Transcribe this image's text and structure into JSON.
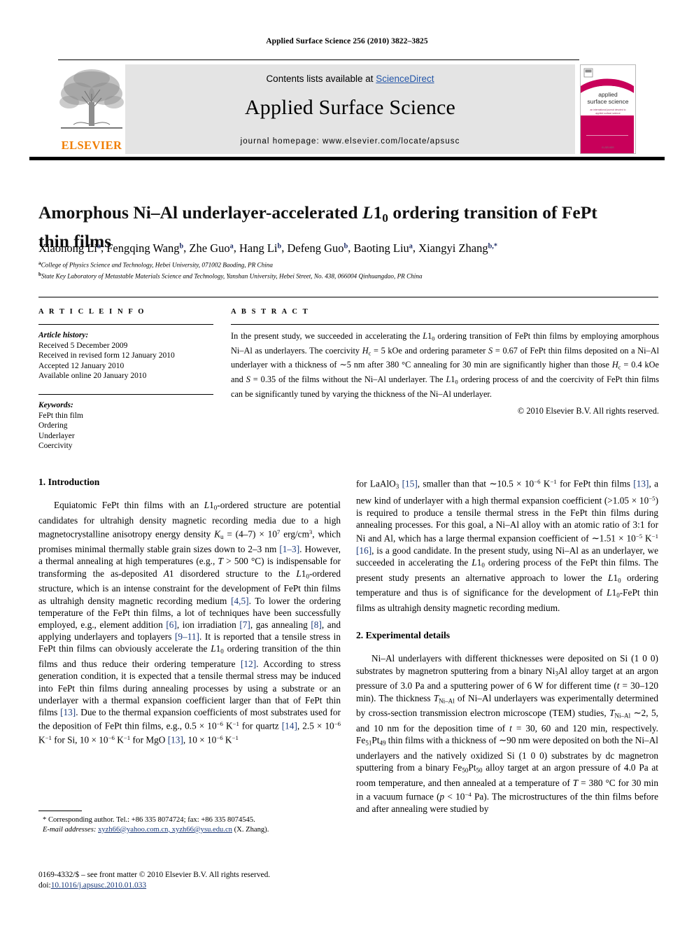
{
  "running_head": "Applied Surface Science 256 (2010) 3822–3825",
  "header": {
    "contents_prefix": "Contents lists available at ",
    "sciencedirect": "ScienceDirect",
    "journal_title": "Applied Surface Science",
    "homepage": "journal homepage: www.elsevier.com/locate/apsusc",
    "publisher_word": "ELSEVIER",
    "publisher_accent_color": "#F07D00",
    "link_color": "#2456a8",
    "cover": {
      "line1": "applied",
      "line2": "surface science",
      "subtitle": "an international journal devoted to applied surface science",
      "footer": "ELSEVIER",
      "accent_color": "#c8005a"
    }
  },
  "article": {
    "title_part1": "Amorphous Ni–Al underlayer-accelerated ",
    "title_italic": "L",
    "title_l1": "1",
    "title_sub": "0",
    "title_part2": " ordering transition of FePt thin films",
    "authors": [
      {
        "name": "Xiaohong Li",
        "mark": "a"
      },
      {
        "name": "Fengqing Wang",
        "mark": "b"
      },
      {
        "name": "Zhe Guo",
        "mark": "a"
      },
      {
        "name": "Hang Li",
        "mark": "b"
      },
      {
        "name": "Defeng Guo",
        "mark": "b"
      },
      {
        "name": "Baoting Liu",
        "mark": "a"
      },
      {
        "name": "Xiangyi Zhang",
        "mark": "b,*"
      }
    ],
    "affiliations": [
      {
        "mark": "a",
        "text": "College of Physics Science and Technology, Hebei University, 071002 Baoding, PR China"
      },
      {
        "mark": "b",
        "text": "State Key Laboratory of Metastable Materials Science and Technology, Yanshan University, Hebei Street, No. 438, 066004 Qinhuangdao, PR China"
      }
    ]
  },
  "article_info": {
    "label": "A R T I C L E   I N F O",
    "history_head": "Article history:",
    "history": [
      "Received 5 December 2009",
      "Received in revised form 12 January 2010",
      "Accepted 12 January 2010",
      "Available online 20 January 2010"
    ],
    "keywords_head": "Keywords:",
    "keywords": [
      "FePt thin film",
      "Ordering",
      "Underlayer",
      "Coercivity"
    ]
  },
  "abstract": {
    "label": "A B S T R A C T",
    "copyright": "© 2010 Elsevier B.V. All rights reserved."
  },
  "sections": {
    "intro_title": "1. Introduction",
    "experimental_title": "2. Experimental details"
  },
  "footnote": {
    "corresponding": "* Corresponding author. Tel.: +86 335 8074724; fax: +86 335 8074545.",
    "email_label": "E-mail addresses:",
    "emails": "xyzh66@yahoo.com.cn, xyzh66@ysu.edu.cn",
    "email_person": "(X. Zhang).",
    "issn_line": "0169-4332/$ – see front matter © 2010 Elsevier B.V. All rights reserved.",
    "doi_label": "doi:",
    "doi_value": "10.1016/j.apsusc.2010.01.033"
  }
}
